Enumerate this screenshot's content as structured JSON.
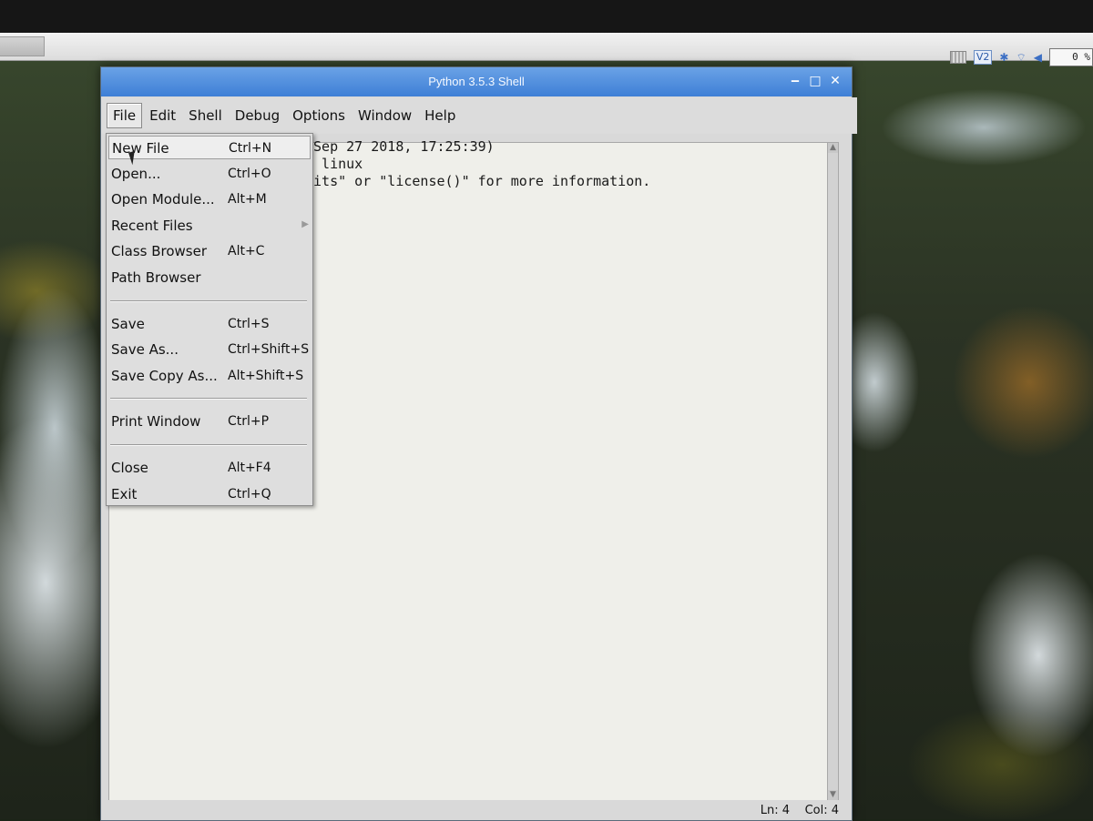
{
  "window": {
    "title": "Python 3.5.3 Shell",
    "controls": {
      "minimize": "‒",
      "maximize": "□",
      "close": "✕"
    }
  },
  "menubar": {
    "items": [
      "File",
      "Edit",
      "Shell",
      "Debug",
      "Options",
      "Window",
      "Help"
    ],
    "active": "File"
  },
  "file_menu": {
    "groups": [
      [
        {
          "label": "New File",
          "accel": "Ctrl+N",
          "hover": true
        },
        {
          "label": "Open...",
          "accel": "Ctrl+O"
        },
        {
          "label": "Open Module...",
          "accel": "Alt+M"
        },
        {
          "label": "Recent Files",
          "accel": "",
          "submenu": true
        },
        {
          "label": "Class Browser",
          "accel": "Alt+C"
        },
        {
          "label": "Path Browser",
          "accel": ""
        }
      ],
      [
        {
          "label": "Save",
          "accel": "Ctrl+S"
        },
        {
          "label": "Save As...",
          "accel": "Ctrl+Shift+S"
        },
        {
          "label": "Save Copy As...",
          "accel": "Alt+Shift+S"
        }
      ],
      [
        {
          "label": "Print Window",
          "accel": "Ctrl+P"
        }
      ],
      [
        {
          "label": "Close",
          "accel": "Alt+F4"
        },
        {
          "label": "Exit",
          "accel": "Ctrl+Q"
        }
      ]
    ]
  },
  "shell": {
    "lines": [
      " Sep 27 2018, 17:25:39)",
      "n linux",
      "dits\" or \"license()\" for more information."
    ]
  },
  "statusbar": {
    "line": "Ln: 4",
    "column": "Col: 4"
  },
  "system_tray": {
    "cpu": "0 %",
    "vnc_label": "V2"
  },
  "colors": {
    "titlebar": "#3e7fd6",
    "menu_bg": "#dedede",
    "text_bg": "#efefea"
  }
}
